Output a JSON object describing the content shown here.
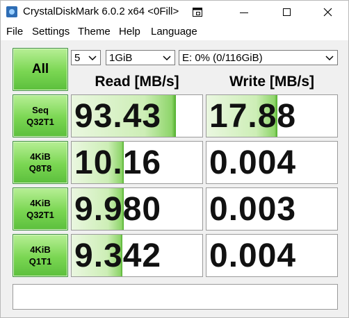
{
  "window": {
    "title": "CrystalDiskMark 6.0.2 x64 <0Fill>"
  },
  "menu": [
    "File",
    "Settings",
    "Theme",
    "Help",
    "Language"
  ],
  "controls": {
    "all_label": "All",
    "count": "5",
    "size": "1GiB",
    "drive": "E: 0% (0/116GiB)"
  },
  "headers": {
    "read": "Read [MB/s]",
    "write": "Write [MB/s]"
  },
  "tests": [
    {
      "line1": "Seq",
      "line2": "Q32T1",
      "read": "93.43",
      "write": "17.88",
      "read_level": 0.8,
      "write_level": 0.54
    },
    {
      "line1": "4KiB",
      "line2": "Q8T8",
      "read": "10.16",
      "write": "0.004",
      "read_level": 0.4,
      "write_level": 0.0
    },
    {
      "line1": "4KiB",
      "line2": "Q32T1",
      "read": "9.980",
      "write": "0.003",
      "read_level": 0.4,
      "write_level": 0.0
    },
    {
      "line1": "4KiB",
      "line2": "Q1T1",
      "read": "9.342",
      "write": "0.004",
      "read_level": 0.39,
      "write_level": 0.0
    }
  ],
  "comment": "",
  "colors": {
    "accent_green": "#5cbf3d",
    "cell_border": "#9a9a9a",
    "window_bg": "#f0f0f0"
  }
}
